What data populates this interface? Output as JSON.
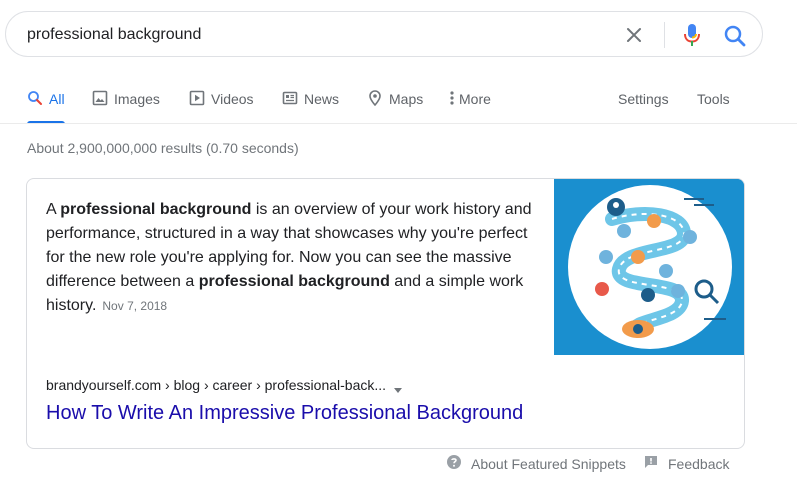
{
  "search": {
    "query": "professional background",
    "placeholder": ""
  },
  "tabs": [
    {
      "label": "All",
      "icon": "search-icon",
      "active": true
    },
    {
      "label": "Images",
      "icon": "image-icon"
    },
    {
      "label": "Videos",
      "icon": "video-icon"
    },
    {
      "label": "News",
      "icon": "news-icon"
    },
    {
      "label": "Maps",
      "icon": "map-pin-icon"
    },
    {
      "label": "More",
      "icon": "more-vert-icon"
    }
  ],
  "tools": {
    "settings_label": "Settings",
    "tools_label": "Tools"
  },
  "results": {
    "stats": "About 2,900,000,000 results (0.70 seconds)"
  },
  "featured_snippet": {
    "text_parts": [
      "A ",
      "professional background",
      " is an overview of your work history and performance, structured in a way that showcases why you're perfect for the new role you're applying for. Now you can see the massive difference between a ",
      "professional background",
      " and a simple work history."
    ],
    "date": "Nov 7, 2018",
    "cite": "brandyourself.com › blog › career › professional-back...",
    "title": "How To Write An Impressive Professional Background"
  },
  "footer": {
    "about_label": "About Featured Snippets",
    "feedback_label": "Feedback"
  },
  "colors": {
    "accent": "#1a73e8",
    "link": "#1a0dab",
    "muted": "#70757a",
    "image_bg": "#1a8fcf"
  }
}
